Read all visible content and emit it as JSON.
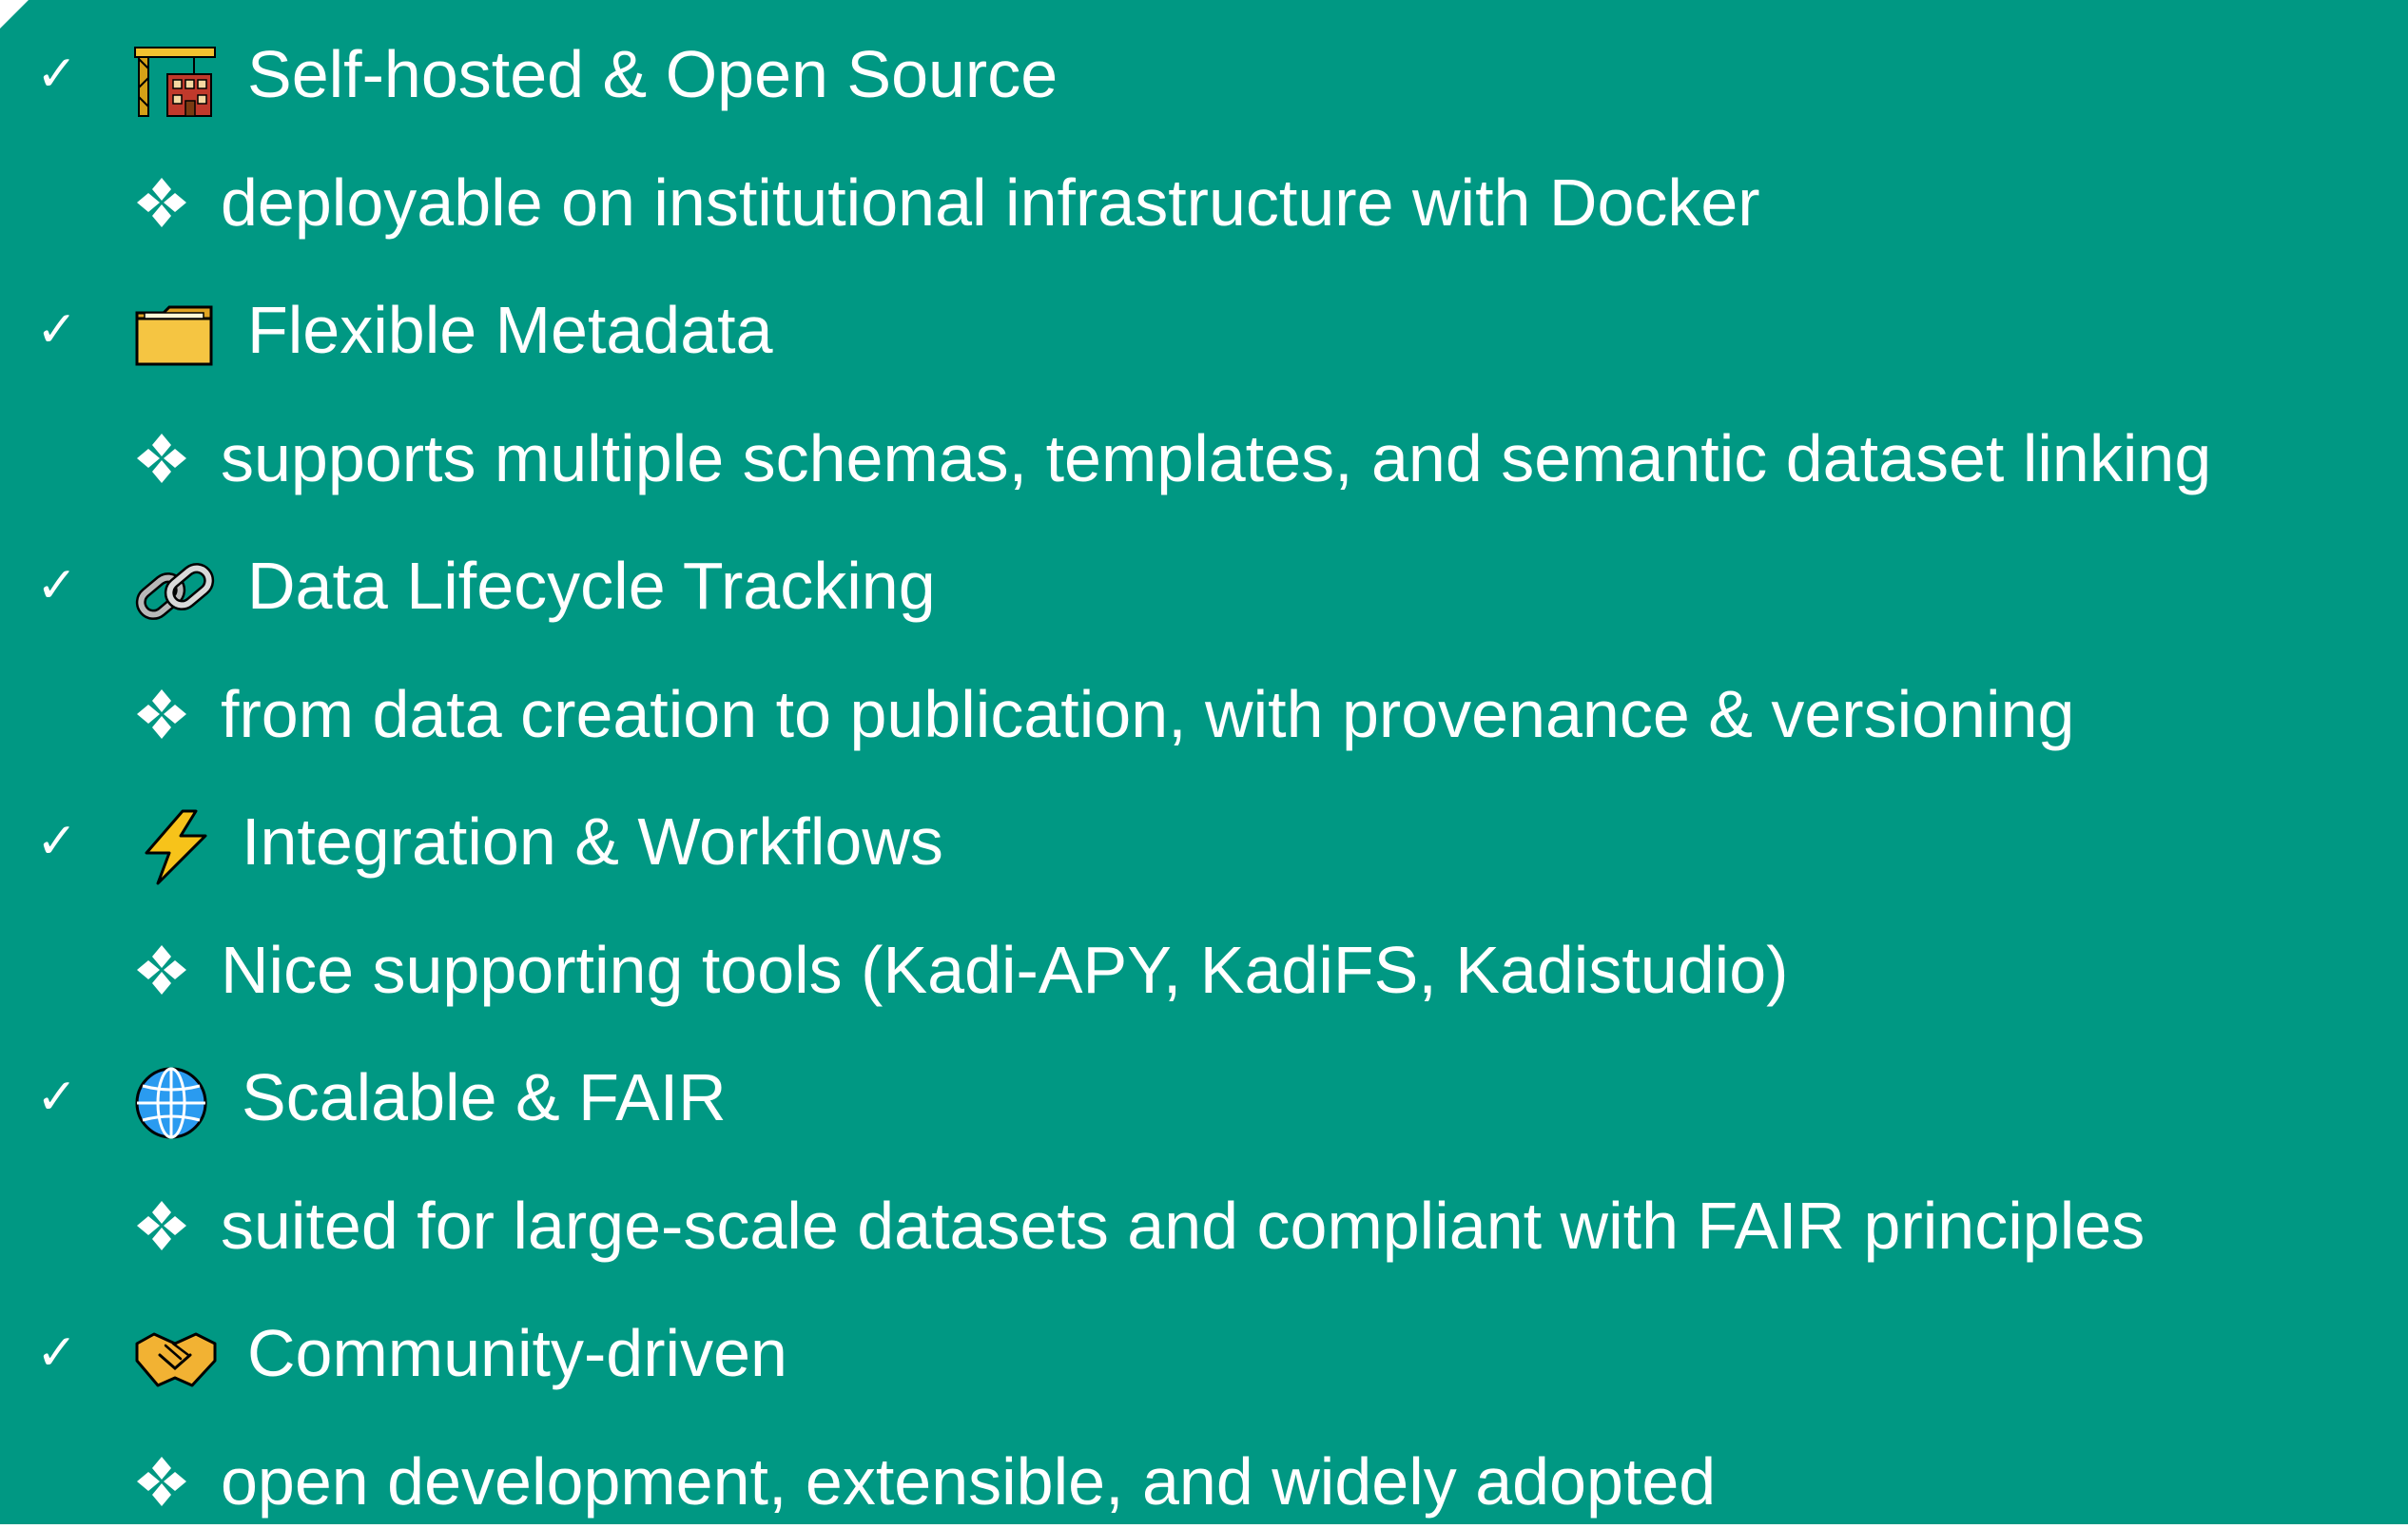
{
  "colors": {
    "panel_background": "#009883",
    "text": "#ffffff"
  },
  "bullet_symbols": {
    "feature": "✓",
    "detail_icon": "four-diamond-icon"
  },
  "features": [
    {
      "icon": "construction-crane-icon",
      "title": "Self-hosted & Open Source",
      "detail": "deployable on institutional infrastructure with Docker"
    },
    {
      "icon": "folder-icon",
      "title": "Flexible Metadata",
      "detail": "supports multiple schemas, templates, and semantic dataset linking"
    },
    {
      "icon": "link-icon",
      "title": "Data Lifecycle Tracking",
      "detail": "from data creation to publication, with provenance & versioning"
    },
    {
      "icon": "lightning-icon",
      "title": "Integration & Workflows",
      "detail": "Nice supporting tools (Kadi-APY, KadiFS, Kadistudio)"
    },
    {
      "icon": "globe-icon",
      "title": "Scalable & FAIR",
      "detail": "suited for large-scale datasets and compliant with FAIR principles"
    },
    {
      "icon": "handshake-icon",
      "title": "Community-driven",
      "detail": "open development, extensible, and widely adopted"
    }
  ]
}
